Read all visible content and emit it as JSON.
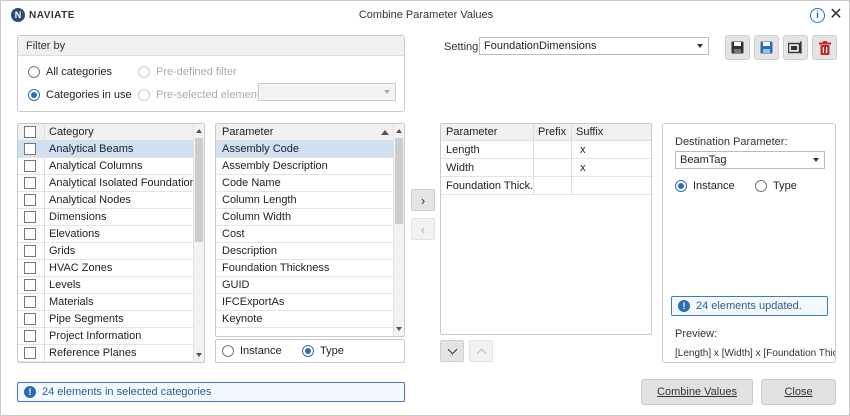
{
  "app": {
    "logo_mark": "N",
    "logo_text": "NAVIATE",
    "title": "Combine Parameter Values"
  },
  "titlebar": {
    "info_icon": "i",
    "close_icon": "✕"
  },
  "filter": {
    "heading": "Filter by",
    "all_categories": "All categories",
    "categories_in_use": "Categories in use",
    "predefined_filter": "Pre-defined filter",
    "preselected_elements": "Pre-selected elements",
    "selected_mode": "categories_in_use"
  },
  "setting": {
    "label": "Setting:",
    "value": "FoundationDimensions"
  },
  "toolbar": {
    "icons": [
      "save-icon",
      "save-as-icon",
      "rename-icon",
      "delete-icon"
    ],
    "colors": {
      "save_as": "#2a6db5",
      "delete": "#c0282d"
    }
  },
  "categories": {
    "header": "Category",
    "items": [
      "Analytical Beams",
      "Analytical Columns",
      "Analytical Isolated Foundations",
      "Analytical Nodes",
      "Dimensions",
      "Elevations",
      "Grids",
      "HVAC Zones",
      "Levels",
      "Materials",
      "Pipe Segments",
      "Project Information",
      "Reference Planes"
    ],
    "selected_index": 0
  },
  "parameters": {
    "header": "Parameter",
    "items": [
      "Assembly Code",
      "Assembly Description",
      "Code Name",
      "Column Length",
      "Column Width",
      "Cost",
      "Description",
      "Foundation Thickness",
      "GUID",
      "IFCExportAs",
      "Keynote"
    ],
    "selected_index": 0,
    "instance_label": "Instance",
    "type_label": "Type",
    "selected_mode": "type"
  },
  "move": {
    "add_icon": "›",
    "remove_icon": "‹",
    "down_icon": "⌄",
    "up_icon": "⌃"
  },
  "combined": {
    "headers": [
      "Parameter",
      "Prefix",
      "Suffix"
    ],
    "rows": [
      {
        "parameter": "Length",
        "prefix": "",
        "suffix": "x"
      },
      {
        "parameter": "Width",
        "prefix": "",
        "suffix": "x"
      },
      {
        "parameter": "Foundation Thick...",
        "prefix": "",
        "suffix": ""
      }
    ]
  },
  "destination": {
    "label": "Destination Parameter:",
    "value": "BeamTag",
    "instance_label": "Instance",
    "type_label": "Type",
    "selected_mode": "instance",
    "status": "24 elements updated.",
    "preview_label": "Preview:",
    "preview_value": "[Length] x [Width] x [Foundation Thicknes"
  },
  "footer": {
    "status": "24 elements in selected categories",
    "combine_label": "Combine Values",
    "close_label": "Close"
  }
}
